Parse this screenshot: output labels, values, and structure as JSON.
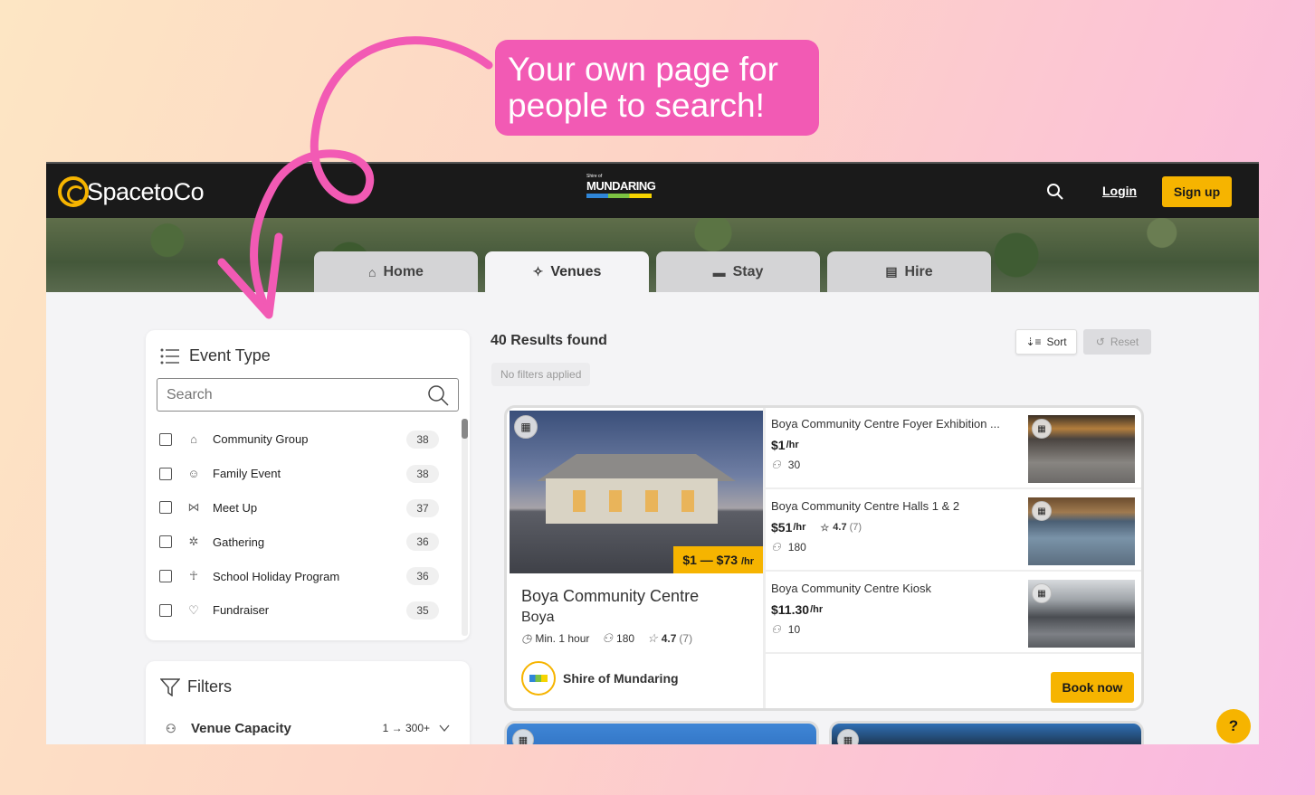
{
  "callout": {
    "line1": "Your own page for",
    "line2": "people to search!"
  },
  "header": {
    "brand": "SpacetoCo",
    "partner_small": "Shire of",
    "partner_big": "MUNDARING",
    "login_label": "Login",
    "signup_label": "Sign up"
  },
  "tabs": [
    {
      "label": "Home",
      "icon": "house-icon"
    },
    {
      "label": "Venues",
      "icon": "party-popper-icon"
    },
    {
      "label": "Stay",
      "icon": "bed-icon"
    },
    {
      "label": "Hire",
      "icon": "projector-icon"
    }
  ],
  "event_type": {
    "title": "Event Type",
    "search_placeholder": "Search",
    "items": [
      {
        "label": "Community Group",
        "count": "38",
        "icon": "community-icon"
      },
      {
        "label": "Family Event",
        "count": "38",
        "icon": "family-icon"
      },
      {
        "label": "Meet Up",
        "count": "37",
        "icon": "handshake-icon"
      },
      {
        "label": "Gathering",
        "count": "36",
        "icon": "network-icon"
      },
      {
        "label": "School Holiday Program",
        "count": "36",
        "icon": "child-icon"
      },
      {
        "label": "Fundraiser",
        "count": "35",
        "icon": "heart-hands-icon"
      }
    ]
  },
  "filters": {
    "title": "Filters",
    "capacity_label": "Venue Capacity",
    "capacity_range": "1 → 300+"
  },
  "results": {
    "title": "40 Results found",
    "filters_status": "No filters applied",
    "sort_label": "Sort",
    "reset_label": "Reset"
  },
  "venue": {
    "price_range": "$1 — $73",
    "price_unit": "/hr",
    "name": "Boya Community Centre",
    "suburb": "Boya",
    "min_booking": "Min. 1 hour",
    "capacity": "180",
    "rating": "4.7",
    "rating_count": "(7)",
    "host": "Shire of Mundaring",
    "book_label": "Book now",
    "spaces": [
      {
        "name": "Boya Community Centre Foyer Exhibition ...",
        "price": "$1",
        "unit": "/hr",
        "capacity": "30",
        "rating": "",
        "rating_count": ""
      },
      {
        "name": "Boya Community Centre Halls 1 & 2",
        "price": "$51",
        "unit": "/hr",
        "capacity": "180",
        "rating": "4.7",
        "rating_count": "(7)"
      },
      {
        "name": "Boya Community Centre Kiosk",
        "price": "$11.30",
        "unit": "/hr",
        "capacity": "10",
        "rating": "",
        "rating_count": ""
      }
    ]
  },
  "help_label": "?",
  "colors": {
    "accent": "#f6b400",
    "callout": "#f25ab4",
    "topbar": "#1a1a1a"
  }
}
